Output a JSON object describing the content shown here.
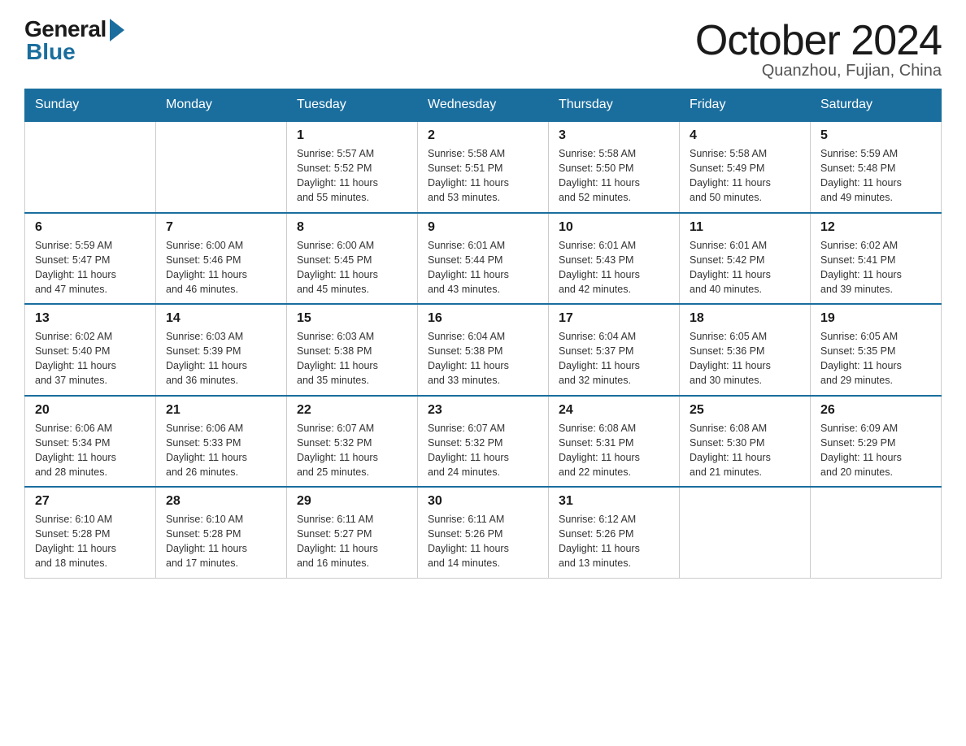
{
  "logo": {
    "general": "General",
    "blue": "Blue"
  },
  "title": {
    "month_year": "October 2024",
    "location": "Quanzhou, Fujian, China"
  },
  "weekdays": [
    "Sunday",
    "Monday",
    "Tuesday",
    "Wednesday",
    "Thursday",
    "Friday",
    "Saturday"
  ],
  "weeks": [
    [
      {
        "day": "",
        "info": ""
      },
      {
        "day": "",
        "info": ""
      },
      {
        "day": "1",
        "info": "Sunrise: 5:57 AM\nSunset: 5:52 PM\nDaylight: 11 hours\nand 55 minutes."
      },
      {
        "day": "2",
        "info": "Sunrise: 5:58 AM\nSunset: 5:51 PM\nDaylight: 11 hours\nand 53 minutes."
      },
      {
        "day": "3",
        "info": "Sunrise: 5:58 AM\nSunset: 5:50 PM\nDaylight: 11 hours\nand 52 minutes."
      },
      {
        "day": "4",
        "info": "Sunrise: 5:58 AM\nSunset: 5:49 PM\nDaylight: 11 hours\nand 50 minutes."
      },
      {
        "day": "5",
        "info": "Sunrise: 5:59 AM\nSunset: 5:48 PM\nDaylight: 11 hours\nand 49 minutes."
      }
    ],
    [
      {
        "day": "6",
        "info": "Sunrise: 5:59 AM\nSunset: 5:47 PM\nDaylight: 11 hours\nand 47 minutes."
      },
      {
        "day": "7",
        "info": "Sunrise: 6:00 AM\nSunset: 5:46 PM\nDaylight: 11 hours\nand 46 minutes."
      },
      {
        "day": "8",
        "info": "Sunrise: 6:00 AM\nSunset: 5:45 PM\nDaylight: 11 hours\nand 45 minutes."
      },
      {
        "day": "9",
        "info": "Sunrise: 6:01 AM\nSunset: 5:44 PM\nDaylight: 11 hours\nand 43 minutes."
      },
      {
        "day": "10",
        "info": "Sunrise: 6:01 AM\nSunset: 5:43 PM\nDaylight: 11 hours\nand 42 minutes."
      },
      {
        "day": "11",
        "info": "Sunrise: 6:01 AM\nSunset: 5:42 PM\nDaylight: 11 hours\nand 40 minutes."
      },
      {
        "day": "12",
        "info": "Sunrise: 6:02 AM\nSunset: 5:41 PM\nDaylight: 11 hours\nand 39 minutes."
      }
    ],
    [
      {
        "day": "13",
        "info": "Sunrise: 6:02 AM\nSunset: 5:40 PM\nDaylight: 11 hours\nand 37 minutes."
      },
      {
        "day": "14",
        "info": "Sunrise: 6:03 AM\nSunset: 5:39 PM\nDaylight: 11 hours\nand 36 minutes."
      },
      {
        "day": "15",
        "info": "Sunrise: 6:03 AM\nSunset: 5:38 PM\nDaylight: 11 hours\nand 35 minutes."
      },
      {
        "day": "16",
        "info": "Sunrise: 6:04 AM\nSunset: 5:38 PM\nDaylight: 11 hours\nand 33 minutes."
      },
      {
        "day": "17",
        "info": "Sunrise: 6:04 AM\nSunset: 5:37 PM\nDaylight: 11 hours\nand 32 minutes."
      },
      {
        "day": "18",
        "info": "Sunrise: 6:05 AM\nSunset: 5:36 PM\nDaylight: 11 hours\nand 30 minutes."
      },
      {
        "day": "19",
        "info": "Sunrise: 6:05 AM\nSunset: 5:35 PM\nDaylight: 11 hours\nand 29 minutes."
      }
    ],
    [
      {
        "day": "20",
        "info": "Sunrise: 6:06 AM\nSunset: 5:34 PM\nDaylight: 11 hours\nand 28 minutes."
      },
      {
        "day": "21",
        "info": "Sunrise: 6:06 AM\nSunset: 5:33 PM\nDaylight: 11 hours\nand 26 minutes."
      },
      {
        "day": "22",
        "info": "Sunrise: 6:07 AM\nSunset: 5:32 PM\nDaylight: 11 hours\nand 25 minutes."
      },
      {
        "day": "23",
        "info": "Sunrise: 6:07 AM\nSunset: 5:32 PM\nDaylight: 11 hours\nand 24 minutes."
      },
      {
        "day": "24",
        "info": "Sunrise: 6:08 AM\nSunset: 5:31 PM\nDaylight: 11 hours\nand 22 minutes."
      },
      {
        "day": "25",
        "info": "Sunrise: 6:08 AM\nSunset: 5:30 PM\nDaylight: 11 hours\nand 21 minutes."
      },
      {
        "day": "26",
        "info": "Sunrise: 6:09 AM\nSunset: 5:29 PM\nDaylight: 11 hours\nand 20 minutes."
      }
    ],
    [
      {
        "day": "27",
        "info": "Sunrise: 6:10 AM\nSunset: 5:28 PM\nDaylight: 11 hours\nand 18 minutes."
      },
      {
        "day": "28",
        "info": "Sunrise: 6:10 AM\nSunset: 5:28 PM\nDaylight: 11 hours\nand 17 minutes."
      },
      {
        "day": "29",
        "info": "Sunrise: 6:11 AM\nSunset: 5:27 PM\nDaylight: 11 hours\nand 16 minutes."
      },
      {
        "day": "30",
        "info": "Sunrise: 6:11 AM\nSunset: 5:26 PM\nDaylight: 11 hours\nand 14 minutes."
      },
      {
        "day": "31",
        "info": "Sunrise: 6:12 AM\nSunset: 5:26 PM\nDaylight: 11 hours\nand 13 minutes."
      },
      {
        "day": "",
        "info": ""
      },
      {
        "day": "",
        "info": ""
      }
    ]
  ]
}
